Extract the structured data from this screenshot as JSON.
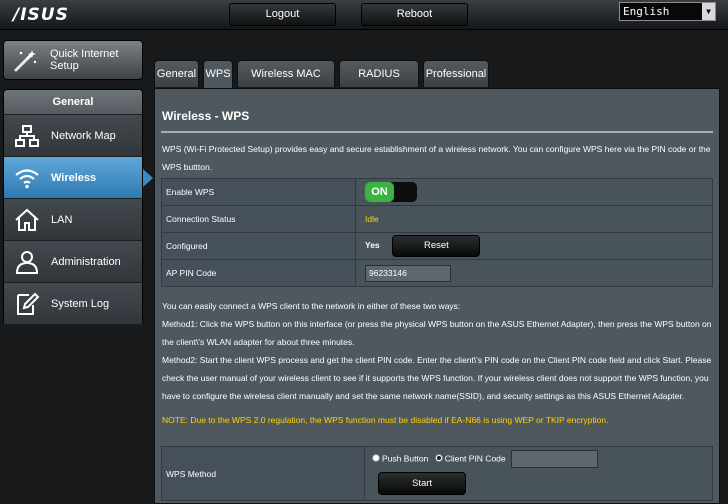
{
  "header": {
    "logo": "/ISUS",
    "logout_label": "Logout",
    "reboot_label": "Reboot",
    "language": "English"
  },
  "sidebar": {
    "quick_setup_label": "Quick Internet Setup",
    "section_title": "General",
    "items": [
      {
        "label": "Network Map",
        "icon": "network-map-icon"
      },
      {
        "label": "Wireless",
        "icon": "wifi-icon",
        "active": true
      },
      {
        "label": "LAN",
        "icon": "home-icon"
      },
      {
        "label": "Administration",
        "icon": "user-icon"
      },
      {
        "label": "System Log",
        "icon": "edit-log-icon"
      }
    ]
  },
  "tabs": [
    {
      "label": "General"
    },
    {
      "label": "WPS",
      "active": true
    },
    {
      "label": "Wireless MAC Filter"
    },
    {
      "label": "RADIUS Setting"
    },
    {
      "label": "Professional"
    }
  ],
  "content": {
    "title": "Wireless - WPS",
    "description": "WPS (Wi-Fi Protected Setup) provides easy and secure establishment of a wireless network. You can configure WPS here via the PIN code or the WPS buttton.",
    "settings": {
      "enable_wps_label": "Enable WPS",
      "enable_wps_value": "ON",
      "connection_status_label": "Connection Status",
      "connection_status_value": "Idle",
      "configured_label": "Configured",
      "configured_value": "Yes",
      "reset_label": "Reset",
      "ap_pin_label": "AP PIN Code",
      "ap_pin_value": "96233146"
    },
    "info_intro": "You can easily connect a WPS client to the network in either of these two ways:",
    "method1": "Method1: Click the WPS button on this interface (or press the physical WPS button on the ASUS Ethernet Adapter), then press the WPS button on the client\\'s WLAN adapter for about three minutes.",
    "method2": "Method2: Start the client WPS process and get the client PIN code. Enter the client\\'s PIN code on the Client PIN code field and click Start. Please check the user manual of your wireless client to see if it supports the WPS function. If your wireless client does not support the WPS function, you have to configure the wireless client manually and set the same network name(SSID), and security settings as this ASUS Ethernet Adapter.",
    "note": "NOTE: Due to the WPS 2.0 regulation, the WPS function must be disabled if EA-N66 is using WEP or TKIP encryption.",
    "wps_method": {
      "label": "WPS Method",
      "option_push": "Push Button",
      "option_pin": "Client PIN Code",
      "selected": "Client PIN Code",
      "client_pin_value": "",
      "start_label": "Start"
    }
  },
  "colors": {
    "accent_blue": "#3b8ac1",
    "toggle_green": "#3bb241",
    "status_yellow": "#ffd400",
    "panel_bg": "#4e585e"
  }
}
